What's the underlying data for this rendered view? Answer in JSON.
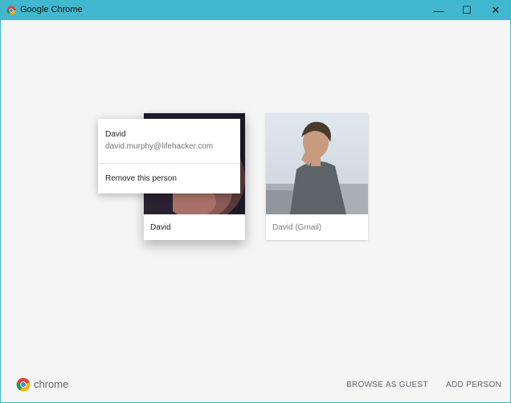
{
  "window": {
    "title": "Google Chrome",
    "controls": {
      "minimize": "—",
      "maximize": "☐",
      "close": "✕"
    }
  },
  "profiles": [
    {
      "name": "David",
      "icon": "user-photo-dark"
    },
    {
      "name": "David (Gmail)",
      "icon": "user-photo-outdoor"
    }
  ],
  "menu": {
    "name": "David",
    "email": "david.murphy@lifehacker.com",
    "remove_label": "Remove this person"
  },
  "footer": {
    "brand": "chrome",
    "browse_guest": "BROWSE AS GUEST",
    "add_person": "ADD PERSON"
  },
  "colors": {
    "titlebar": "#41b8cf",
    "background": "#f5f5f5"
  }
}
